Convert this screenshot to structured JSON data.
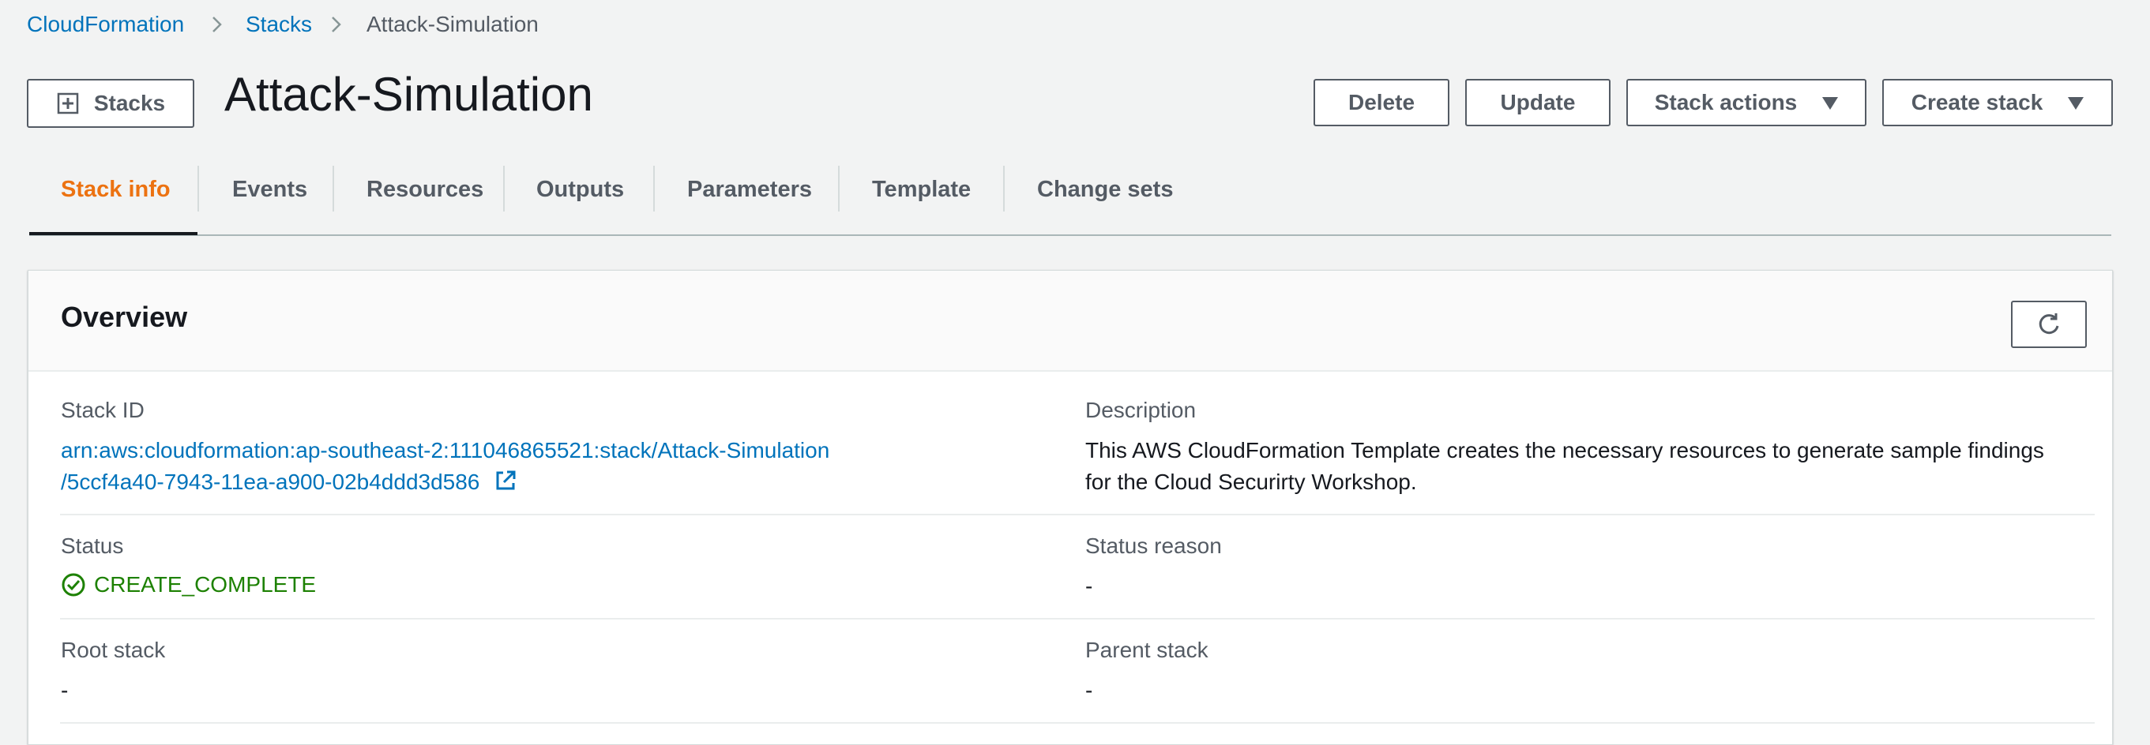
{
  "breadcrumb": {
    "items": [
      {
        "label": "CloudFormation"
      },
      {
        "label": "Stacks"
      },
      {
        "label": "Attack-Simulation"
      }
    ]
  },
  "header": {
    "stacks_button": "Stacks",
    "title": "Attack-Simulation",
    "actions": {
      "delete": "Delete",
      "update": "Update",
      "stack_actions": "Stack actions",
      "create_stack": "Create stack"
    }
  },
  "tabs": [
    {
      "label": "Stack info",
      "active": true
    },
    {
      "label": "Events"
    },
    {
      "label": "Resources"
    },
    {
      "label": "Outputs"
    },
    {
      "label": "Parameters"
    },
    {
      "label": "Template"
    },
    {
      "label": "Change sets"
    }
  ],
  "overview": {
    "title": "Overview",
    "stack_id_label": "Stack ID",
    "stack_id_line1": "arn:aws:cloudformation:ap-southeast-2:111046865521:stack/Attack-Simulation",
    "stack_id_line2": "/5ccf4a40-7943-11ea-a900-02b4ddd3d586",
    "description_label": "Description",
    "description_line1": "This AWS CloudFormation Template creates the necessary resources to generate sample findings",
    "description_line2": "for the Cloud Securirty Workshop.",
    "status_label": "Status",
    "status_value": "CREATE_COMPLETE",
    "status_reason_label": "Status reason",
    "status_reason_value": "-",
    "root_stack_label": "Root stack",
    "root_stack_value": "-",
    "parent_stack_label": "Parent stack",
    "parent_stack_value": "-"
  },
  "colors": {
    "link": "#0073bb",
    "active_tab": "#ec7211",
    "success": "#1d8102",
    "background": "#f2f3f3"
  }
}
